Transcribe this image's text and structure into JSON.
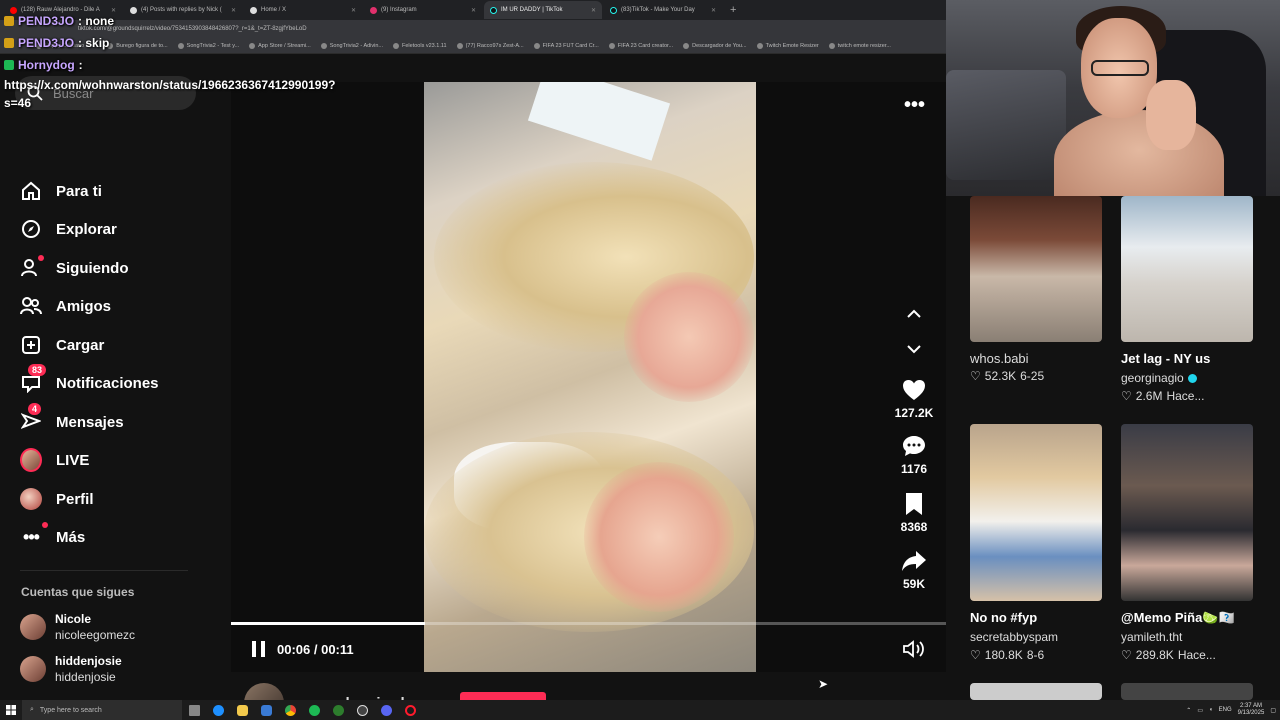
{
  "browser": {
    "tabs": [
      {
        "label": "(128) Rauw Alejandro - Dile A ",
        "active": false
      },
      {
        "label": "(4) Posts with replies by Nick (",
        "active": false
      },
      {
        "label": "Home / X",
        "active": false
      },
      {
        "label": "(9) Instagram",
        "active": false
      },
      {
        "label": "IM UR DADDY | TikTok",
        "active": true
      },
      {
        "label": "(83)TikTok - Make Your Day",
        "active": false
      }
    ],
    "new_tab": "+",
    "url": "tiktok.com/@groundsquirrelz/video/7534153903848426807?_r=1&_t=ZT-8zgjfYbeLoD",
    "bookmarks": [
      "Happy Cristiano Ro...",
      "Burego figura de to...",
      "SongTrivia2 - Test y...",
      "App Store / Streami...",
      "SongTrivia2 - Adivin...",
      "Feletools v23.1.11",
      "(77) Racco97s Zest-A...",
      "FIFA 23 FUT Card Cr...",
      "FIFA 23 Card creator...",
      "Descargador de You...",
      "Twitch Emote Resizer",
      "twitch emote resizer..."
    ]
  },
  "chat": {
    "lines": [
      {
        "user": "PEND3JO",
        "message": ": none"
      },
      {
        "user": "PEND3JO",
        "message": ": skip"
      },
      {
        "user": "Hornydog",
        "message": ":"
      }
    ],
    "link": "https://x.com/wohnwarston/status/1966236367412990199?s=46"
  },
  "sidebar": {
    "search_placeholder": "Buscar",
    "nav": [
      {
        "label": "Para ti",
        "icon": "home-icon"
      },
      {
        "label": "Explorar",
        "icon": "compass-icon"
      },
      {
        "label": "Siguiendo",
        "icon": "following-icon"
      },
      {
        "label": "Amigos",
        "icon": "friends-icon"
      },
      {
        "label": "Cargar",
        "icon": "upload-icon"
      },
      {
        "label": "Notificaciones",
        "icon": "inbox-icon",
        "count": "83"
      },
      {
        "label": "Mensajes",
        "icon": "messages-icon",
        "count": "4"
      },
      {
        "label": "LIVE",
        "icon": "live-icon"
      },
      {
        "label": "Perfil",
        "icon": "profile-icon"
      },
      {
        "label": "Más",
        "icon": "more-icon"
      }
    ],
    "following_title": "Cuentas que sigues",
    "accounts": [
      {
        "name": "Nicole",
        "handle": "nicoleegomezc"
      },
      {
        "name": "hiddenjosie",
        "handle": "hiddenjosie"
      }
    ]
  },
  "video": {
    "author": "groundsquirrelz",
    "time": "00:06 / 00:11",
    "progress": 0.27,
    "likes": "127.2K",
    "comments": "1176",
    "saves": "8368",
    "shares": "59K"
  },
  "recommended": [
    {
      "title": "whos.babi",
      "user": "",
      "likes": "52.3K",
      "date": "6-25",
      "verified": false
    },
    {
      "title": "Jet lag - NY us",
      "user": "georginagio",
      "likes": "2.6M",
      "date": "Hace...",
      "verified": true
    },
    {
      "title": "No no #fyp",
      "user": "secretabbyspam",
      "likes": "180.8K",
      "date": "8-6",
      "verified": false
    },
    {
      "title": "@Memo Piña🍋‍🟩🇽🇽",
      "user": "yamileth.tht",
      "likes": "289.8K",
      "date": "Hace...",
      "verified": false
    }
  ],
  "taskbar": {
    "search_placeholder": "Type here to search",
    "language": "ENG",
    "time": "2:37 AM",
    "date": "9/13/2025"
  },
  "colors": {
    "accent": "#fe2c55",
    "background": "#121212",
    "verified": "#20d5ec"
  }
}
